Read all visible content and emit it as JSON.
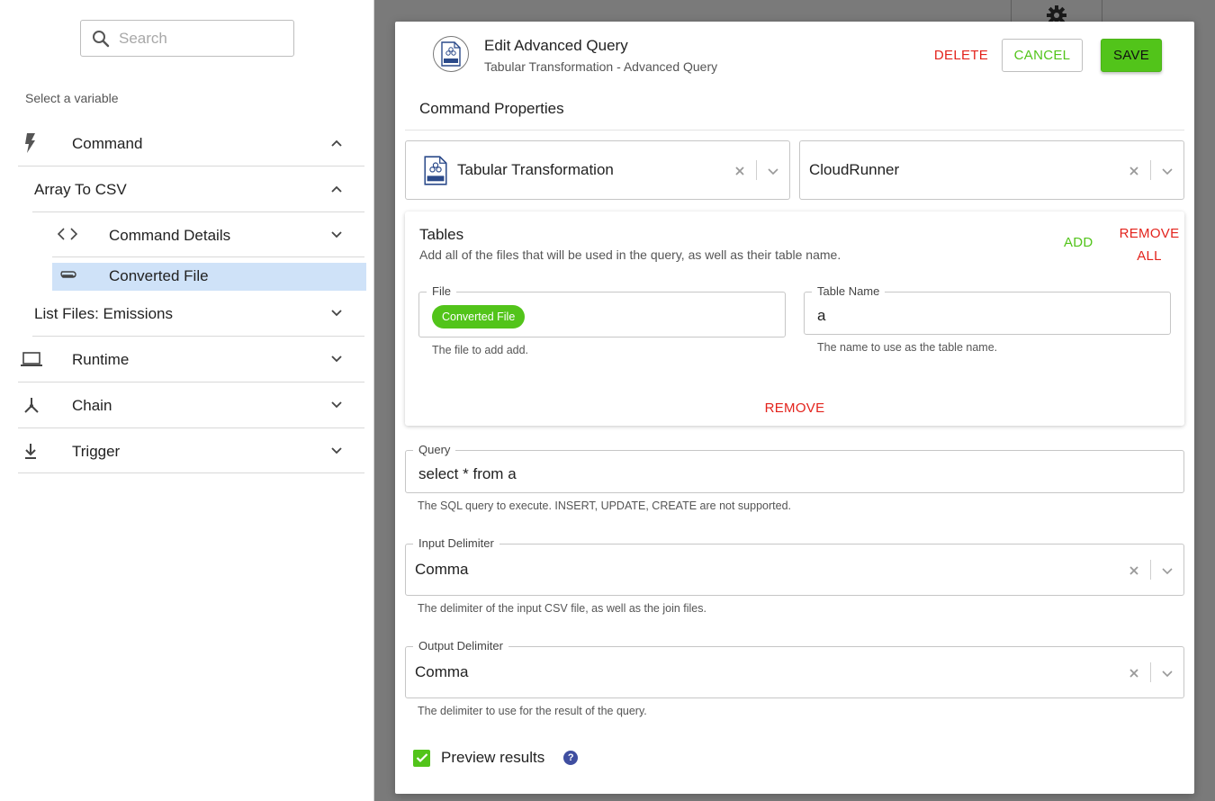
{
  "sidebar": {
    "search_placeholder": "Search",
    "select_label": "Select a variable",
    "items": [
      {
        "label": "Command",
        "icon": "lightning-icon"
      },
      {
        "label": "Array To CSV"
      },
      {
        "label": "Command Details",
        "icon": "code-icon"
      },
      {
        "label": "Converted File",
        "icon": "paperclip-icon"
      },
      {
        "label": "List Files: Emissions"
      },
      {
        "label": "Runtime",
        "icon": "laptop-icon"
      },
      {
        "label": "Chain",
        "icon": "chain-icon"
      },
      {
        "label": "Trigger",
        "icon": "download-icon"
      }
    ]
  },
  "dialog": {
    "title": "Edit Advanced Query",
    "subtitle": "Tabular Transformation - Advanced Query",
    "delete_label": "DELETE",
    "cancel_label": "CANCEL",
    "save_label": "SAVE",
    "section_title": "Command Properties",
    "command_select": "Tabular Transformation",
    "runner_select": "CloudRunner",
    "tables": {
      "title": "Tables",
      "description": "Add all of the files that will be used in the query, as well as their table name.",
      "add_label": "ADD",
      "remove_all_label": "REMOVE ALL",
      "remove_label": "REMOVE",
      "file_legend": "File",
      "file_chip": "Converted File",
      "file_helper": "The file to add add.",
      "table_name_legend": "Table Name",
      "table_name_value": "a",
      "table_name_helper": "The name to use as the table name."
    },
    "query": {
      "legend": "Query",
      "value": "select * from a",
      "helper": "The SQL query to execute. INSERT, UPDATE, CREATE are not supported."
    },
    "input_delimiter": {
      "legend": "Input Delimiter",
      "value": "Comma",
      "helper": "The delimiter of the input CSV file, as well as the join files."
    },
    "output_delimiter": {
      "legend": "Output Delimiter",
      "value": "Comma",
      "helper": "The delimiter to use for the result of the query."
    },
    "preview_label": "Preview results",
    "help_glyph": "?"
  },
  "colors": {
    "accent_green": "#52c41a",
    "danger_red": "#e3231c",
    "selected_row": "#cfe2f8",
    "help_blue": "#3f4ea0"
  }
}
